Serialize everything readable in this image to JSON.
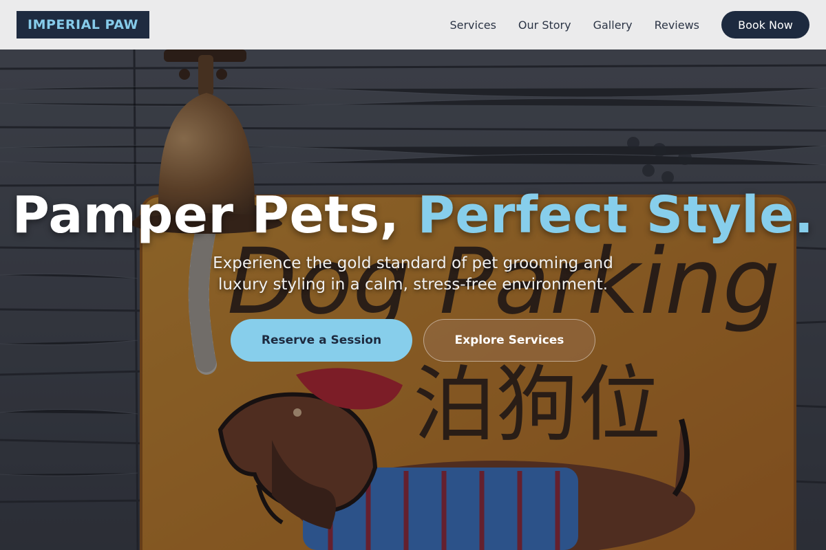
{
  "brand": {
    "logo_text": "IMPERIAL PAW",
    "navy": "#1e2b40",
    "accent": "#87ceeb"
  },
  "nav": {
    "links": [
      "Services",
      "Our Story",
      "Gallery",
      "Reviews"
    ],
    "cta": "Book Now"
  },
  "hero": {
    "headline_main": "Pamper Pets, ",
    "headline_accent": "Perfect Style.",
    "subtitle": "Experience the gold standard of pet grooming and luxury styling in a calm, stress-free environment.",
    "primary_cta": "Reserve a Session",
    "secondary_cta": "Explore Services",
    "background": {
      "sign_text_en": "Dog Parking",
      "sign_text_zh": "泊狗位",
      "elements": [
        "brass-bell",
        "wood-plank-wall",
        "orange-sign",
        "dachshund-illustration",
        "paw-prints"
      ]
    }
  }
}
